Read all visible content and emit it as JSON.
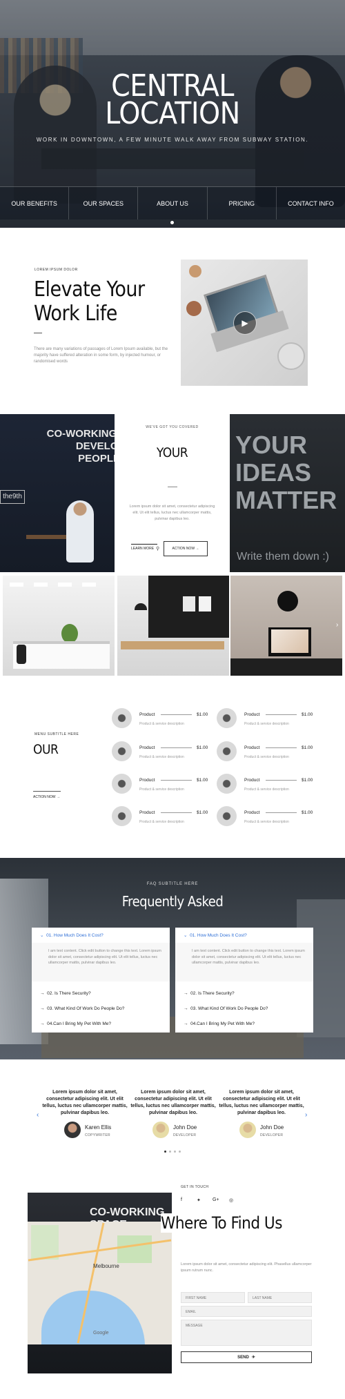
{
  "hero": {
    "title_line1": "CENTRAL",
    "title_line2": "LOCATION",
    "subtitle": "WORK IN DOWNTOWN, A FEW MINUTE WALK AWAY FROM SUBWAY STATION.",
    "nav": [
      "OUR BENEFITS",
      "OUR SPACES",
      "ABOUT US",
      "PRICING",
      "CONTACT INFO"
    ]
  },
  "elevate": {
    "label": "LOREM IPSUM DOLOR",
    "title_line1": "Elevate Your",
    "title_line2": "Work Life",
    "text": "There are many variations of passages of Lorem Ipsum available, but the majority have suffered alteration in some form, by injected humour, or randomised words"
  },
  "covered": {
    "walls": {
      "coworking": "CO-WORKING SPACE DEVELOPMENT PEOPLE IDEAS",
      "sign": "the9th",
      "ideas": "YOUR IDEAS MATTER",
      "write": "Write them down :)"
    },
    "label": "WE'VE GOT YOU COVERED",
    "title": "YOUR",
    "text": "Lorem ipsum dolor sit amet, consectetur adipiscing elit. Ut elit tellus, luctus nec ullamcorper mattis, pulvinar dapibus leo.",
    "learn": "LEARN MORE",
    "action": "ACTION NOW"
  },
  "menu": {
    "label": "MENU SUBTITLE HERE",
    "title": "OUR",
    "action": "ACTION NOW",
    "items": [
      {
        "name": "Product",
        "price": "$1.00",
        "desc": "Product & service description"
      },
      {
        "name": "Product",
        "price": "$1.00",
        "desc": "Product & service description"
      },
      {
        "name": "Product",
        "price": "$1.00",
        "desc": "Product & service description"
      },
      {
        "name": "Product",
        "price": "$1.00",
        "desc": "Product & service description"
      },
      {
        "name": "Product",
        "price": "$1.00",
        "desc": "Product & service description"
      },
      {
        "name": "Product",
        "price": "$1.00",
        "desc": "Product & service description"
      },
      {
        "name": "Product",
        "price": "$1.00",
        "desc": "Product & service description"
      },
      {
        "name": "Product",
        "price": "$1.00",
        "desc": "Product & service description"
      }
    ]
  },
  "faq": {
    "label": "FAQ SUBTITLE HERE",
    "title": "Frequently Asked",
    "cards": [
      {
        "open_q": "01. How Much Does It Cost?",
        "answer": "I am text content. Click edit button to change this text. Lorem ipsum dolor sit amet, consectetur adipiscing elit. Ut elit tellus, luctus nec ullamcorper mattis, pulvinar dapibus leo.",
        "questions": [
          "02. Is There Security?",
          "03. What Kind Of Work Do People Do?",
          "04.Can I Bring My Pet With Me?"
        ]
      },
      {
        "open_q": "01. How Much Does It Cost?",
        "answer": "I am text content. Click edit button to change this text. Lorem ipsum dolor sit amet, consectetur adipiscing elit. Ut elit tellus, luctus nec ullamcorper mattis, pulvinar dapibus leo.",
        "questions": [
          "02. Is There Security?",
          "03. What Kind Of Work Do People Do?",
          "04.Can I Bring My Pet With Me?"
        ]
      }
    ]
  },
  "testimonials": [
    {
      "text": "Lorem ipsum dolor sit amet, consectetur adipiscing elit. Ut elit tellus, luctus nec ullamcorper mattis, pulvinar dapibus leo.",
      "name": "Karen Ellis",
      "role": "COPYWRITER"
    },
    {
      "text": "Lorem ipsum dolor sit amet, consectetur adipiscing elit. Ut elit tellus, luctus nec ullamcorper mattis, pulvinar dapibus leo.",
      "name": "John Doe",
      "role": "DEVELOPER"
    },
    {
      "text": "Lorem ipsum dolor sit amet, consectetur adipiscing elit. Ut elit tellus, luctus nec ullamcorper mattis, pulvinar dapibus leo.",
      "name": "John Doe",
      "role": "DEVELOPER"
    }
  ],
  "findus": {
    "photo_text": "CO-WORKING SPACE",
    "map_city": "Melbourne",
    "map_credit": "Google",
    "label": "GET IN TOUCH",
    "social": [
      "facebook-icon",
      "twitter-icon",
      "google-plus-icon",
      "instagram-icon"
    ],
    "title": "Where To Find Us",
    "text": "Lorem ipsum dolor sit amet, consectetur adipiscing elit. Phasellus ullamcorper ipsum rutrum nunc.",
    "first_name": "FIRST NAME",
    "last_name": "LAST NAME",
    "email": "EMAIL",
    "message": "MESSAGE",
    "send": "SEND"
  },
  "colors": {
    "accent": "#2f6fd6",
    "dark": "#111111"
  }
}
